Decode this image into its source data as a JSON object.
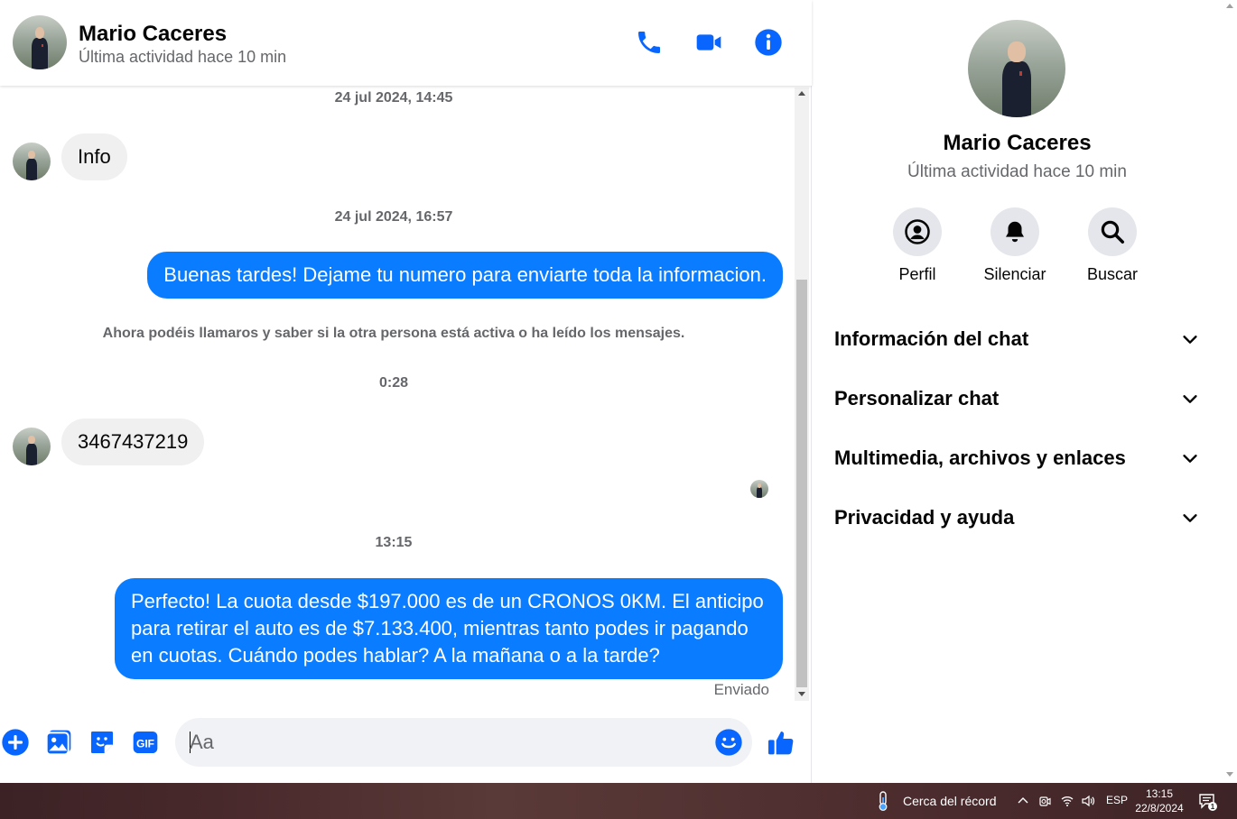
{
  "contact": {
    "name": "Mario Caceres",
    "status": "Última actividad hace 10 min"
  },
  "header_actions": {
    "call_icon": "phone-icon",
    "video_icon": "video-camera-icon",
    "info_icon": "info-icon"
  },
  "messages": {
    "timestamp_1": "24 jul 2024, 14:45",
    "incoming_1": "Info",
    "timestamp_2": "24 jul 2024, 16:57",
    "outgoing_1": "Buenas tardes! Dejame tu numero para enviarte toda la informacion.",
    "system_notice": "Ahora podéis llamaros y saber si la otra persona está activa o ha leído los mensajes.",
    "timestamp_3": "0:28",
    "incoming_2": "3467437219",
    "timestamp_4": "13:15",
    "outgoing_2": "Perfecto! La cuota desde $197.000 es de un CRONOS 0KM. El anticipo para retirar el auto es de $7.133.400, mientras tanto podes ir pagando en cuotas. Cuándo podes hablar? A la mañana o a la tarde?",
    "sent_status": "Enviado"
  },
  "composer": {
    "placeholder": "Aa",
    "value": "",
    "icons": [
      "plus-icon",
      "image-icon",
      "sticker-icon",
      "gif-icon",
      "emoji-icon",
      "thumbs-up-icon"
    ],
    "gif_label": "GIF"
  },
  "info_panel": {
    "actions": [
      {
        "label": "Perfil",
        "icon": "profile-icon"
      },
      {
        "label": "Silenciar",
        "icon": "bell-icon"
      },
      {
        "label": "Buscar",
        "icon": "search-icon"
      }
    ],
    "sections": [
      {
        "label": "Información del chat"
      },
      {
        "label": "Personalizar chat"
      },
      {
        "label": "Multimedia, archivos y enlaces"
      },
      {
        "label": "Privacidad y ayuda"
      }
    ]
  },
  "taskbar": {
    "weather": "Cerca del récord",
    "language": "ESP",
    "time": "13:15",
    "date": "22/8/2024",
    "notification_count": "1"
  },
  "colors": {
    "accent": "#0a7cff",
    "icon_blue": "#0866ff",
    "incoming_bubble": "#f0f0f0",
    "muted_text": "#65676b"
  }
}
